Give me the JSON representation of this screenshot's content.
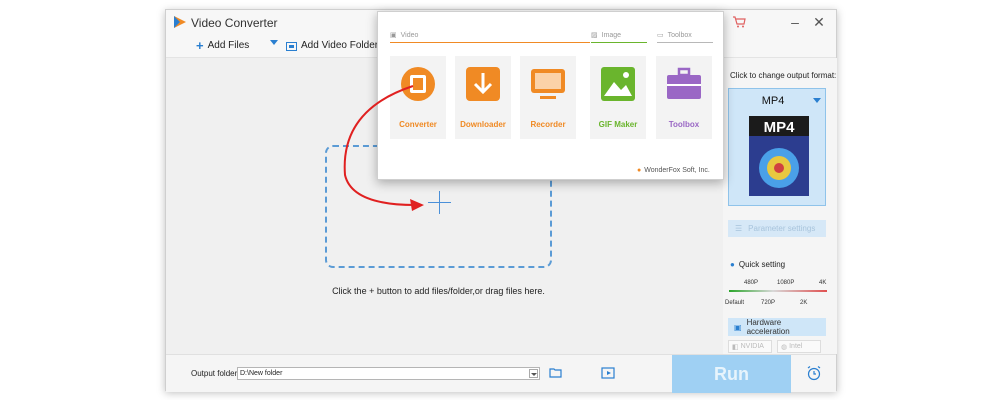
{
  "window": {
    "title": "Video Converter"
  },
  "toolbar": {
    "add_files": "Add Files",
    "add_video_folder": "Add Video Folder"
  },
  "main": {
    "hint": "Click the + button to add files/folder,or drag files here."
  },
  "right_panel": {
    "label": "Click to change output format:",
    "format": "MP4",
    "format_badge": "MP4",
    "parameter_settings": "Parameter settings",
    "quick_setting": "Quick setting",
    "slider_top": [
      "480P",
      "1080P",
      "4K"
    ],
    "slider_bottom": [
      "Default",
      "720P",
      "2K"
    ],
    "hardware_acceleration": "Hardware acceleration",
    "chips": [
      "NVIDIA",
      "Intel"
    ]
  },
  "bottom": {
    "output_folder_label": "Output folder:",
    "output_folder_value": "D:\\New folder",
    "run": "Run"
  },
  "popup": {
    "sections": {
      "video": "Video",
      "image": "Image",
      "toolbox": "Toolbox"
    },
    "tiles": [
      {
        "label": "Converter",
        "color": "#f08a24"
      },
      {
        "label": "Downloader",
        "color": "#f08a24"
      },
      {
        "label": "Recorder",
        "color": "#f08a24"
      },
      {
        "label": "GIF Maker",
        "color": "#6ab52d"
      },
      {
        "label": "Toolbox",
        "color": "#9a67c5"
      }
    ],
    "brand": "WonderFox Soft, Inc."
  },
  "colors": {
    "accent": "#4a90d9",
    "orange": "#f08a24",
    "green": "#6ab52d",
    "purple": "#9a67c5",
    "arrow": "#e02020"
  }
}
